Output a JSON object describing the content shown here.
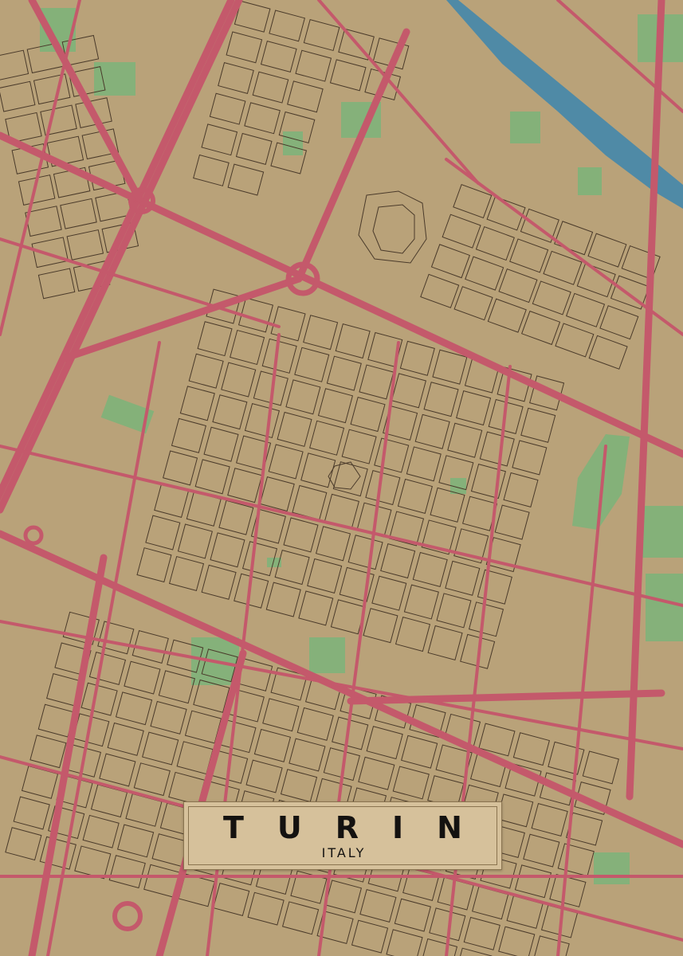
{
  "title": {
    "city": "TURIN",
    "country": "ITALY"
  },
  "colors": {
    "land": "#b9a279",
    "road": "#c4596b",
    "building_outline": "#4a3a2a",
    "park": "#7fb37a",
    "water": "#4f8aa6",
    "card_background": "#d6c19b",
    "card_border": "#8a7450",
    "text": "#141210"
  },
  "features": {
    "river": "river-canal",
    "squares": [
      "roundabout-north",
      "roundabout-south-west",
      "piazza-center"
    ],
    "parks": [
      "park-north-west",
      "park-east",
      "park-south-center",
      "park-north-center"
    ]
  }
}
